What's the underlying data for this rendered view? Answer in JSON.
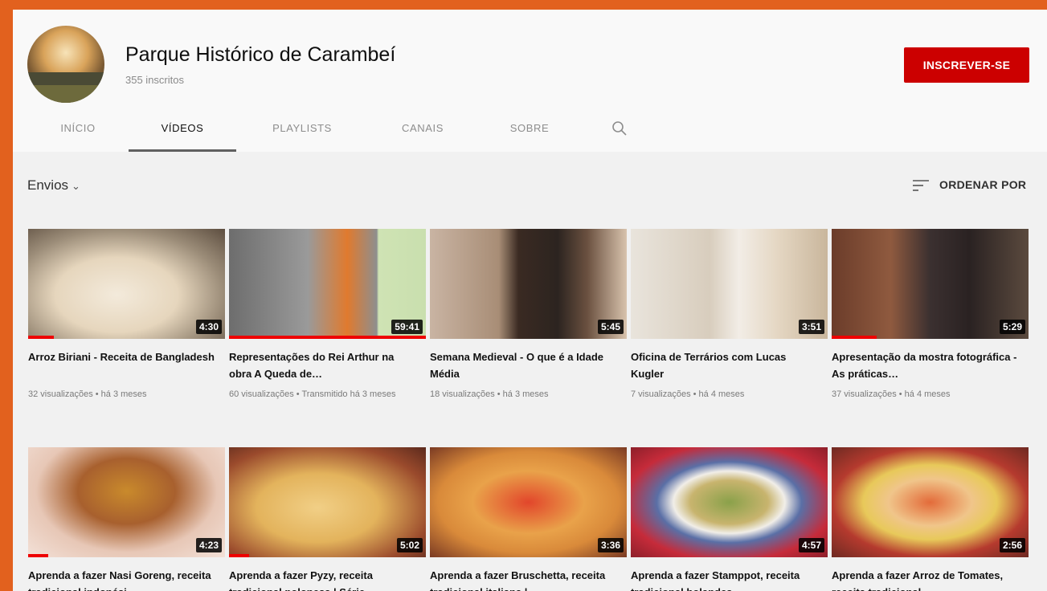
{
  "channel": {
    "name": "Parque Histórico de Carambeí",
    "subscribers": "355 inscritos",
    "subscribe_label": "INSCREVER-SE"
  },
  "tabs": [
    {
      "label": "INÍCIO"
    },
    {
      "label": "VÍDEOS"
    },
    {
      "label": "PLAYLISTS"
    },
    {
      "label": "CANAIS"
    },
    {
      "label": "SOBRE"
    }
  ],
  "uploads": {
    "label": "Envios",
    "sort_label": "ORDENAR POR"
  },
  "videos": [
    {
      "title": "Arroz Biriani - Receita de Bangladesh",
      "meta": "32 visualizações • há 3 meses",
      "duration": "4:30",
      "watched": 0.13
    },
    {
      "title": "Representações do Rei Arthur na obra A Queda de…",
      "meta": "60 visualizações • Transmitido há 3 meses",
      "duration": "59:41",
      "watched": 1.0
    },
    {
      "title": "Semana Medieval - O que é a Idade Média",
      "meta": "18 visualizações • há 3 meses",
      "duration": "5:45",
      "watched": 0
    },
    {
      "title": "Oficina de Terrários com Lucas Kugler",
      "meta": "7 visualizações • há 4 meses",
      "duration": "3:51",
      "watched": 0
    },
    {
      "title": "Apresentação da mostra fotográfica - As práticas…",
      "meta": "37 visualizações • há 4 meses",
      "duration": "5:29",
      "watched": 0.23
    },
    {
      "title": "Aprenda a fazer Nasi Goreng, receita tradicional indonési…",
      "meta": "",
      "duration": "4:23",
      "watched": 0.1
    },
    {
      "title": "Aprenda a fazer Pyzy, receita tradicional polonesa | Série…",
      "meta": "",
      "duration": "5:02",
      "watched": 0.1
    },
    {
      "title": "Aprenda a fazer Bruschetta, receita tradicional italiana |…",
      "meta": "",
      "duration": "3:36",
      "watched": 0
    },
    {
      "title": "Aprenda a fazer Stamppot, receita tradicional holandes…",
      "meta": "",
      "duration": "4:57",
      "watched": 0
    },
    {
      "title": "Aprenda a fazer Arroz de Tomates, receita tradicional…",
      "meta": "",
      "duration": "2:56",
      "watched": 0
    }
  ],
  "colors": {
    "brand_frame": "#e2611e",
    "subscribe": "#cc0000",
    "progress": "#ee0000"
  },
  "icons": [
    "search-icon",
    "sort-icon",
    "chevron-down-icon"
  ]
}
